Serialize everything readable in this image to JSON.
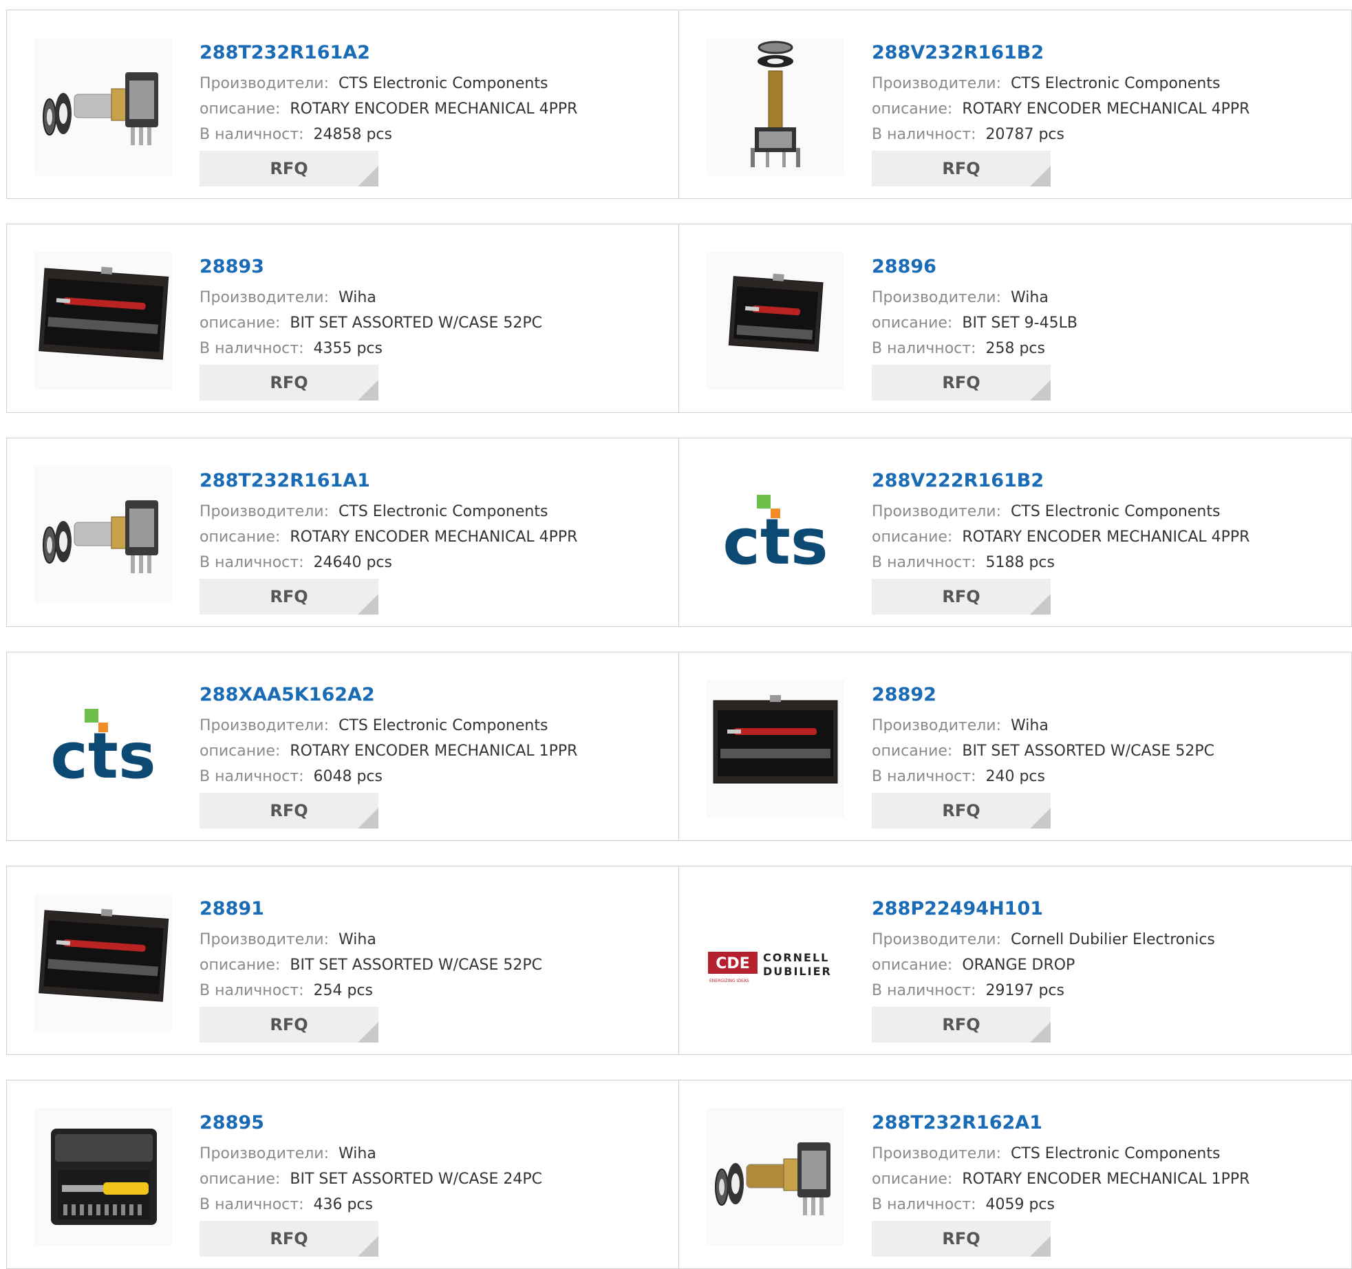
{
  "labels": {
    "manufacturer": "Производители:",
    "description": "описание:",
    "stock": "В наличност:",
    "rfq": "RFQ"
  },
  "products": [
    {
      "pn": "288T232R161A2",
      "mfr": "CTS Electronic Components",
      "desc": "ROTARY ENCODER MECHANICAL 4PPR",
      "stock": "24858 pcs",
      "image": "encoder-horizontal"
    },
    {
      "pn": "288V232R161B2",
      "mfr": "CTS Electronic Components",
      "desc": "ROTARY ENCODER MECHANICAL 4PPR",
      "stock": "20787 pcs",
      "image": "encoder-vertical"
    },
    {
      "pn": "28893",
      "mfr": "Wiha",
      "desc": "BIT SET ASSORTED W/CASE 52PC",
      "stock": "4355 pcs",
      "image": "bit-case"
    },
    {
      "pn": "28896",
      "mfr": "Wiha",
      "desc": "BIT SET 9-45LB",
      "stock": "258 pcs",
      "image": "bit-case-small"
    },
    {
      "pn": "288T232R161A1",
      "mfr": "CTS Electronic Components",
      "desc": "ROTARY ENCODER MECHANICAL 4PPR",
      "stock": "24640 pcs",
      "image": "encoder-horizontal"
    },
    {
      "pn": "288V222R161B2",
      "mfr": "CTS Electronic Components",
      "desc": "ROTARY ENCODER MECHANICAL 4PPR",
      "stock": "5188 pcs",
      "image": "cts-logo"
    },
    {
      "pn": "288XAA5K162A2",
      "mfr": "CTS Electronic Components",
      "desc": "ROTARY ENCODER MECHANICAL 1PPR",
      "stock": "6048 pcs",
      "image": "cts-logo"
    },
    {
      "pn": "28892",
      "mfr": "Wiha",
      "desc": "BIT SET ASSORTED W/CASE 52PC",
      "stock": "240 pcs",
      "image": "bit-case-open"
    },
    {
      "pn": "28891",
      "mfr": "Wiha",
      "desc": "BIT SET ASSORTED W/CASE 52PC",
      "stock": "254 pcs",
      "image": "bit-case"
    },
    {
      "pn": "288P22494H101",
      "mfr": "Cornell Dubilier Electronics",
      "desc": "ORANGE DROP",
      "stock": "29197 pcs",
      "image": "cde-logo"
    },
    {
      "pn": "28895",
      "mfr": "Wiha",
      "desc": "BIT SET ASSORTED W/CASE 24PC",
      "stock": "436 pcs",
      "image": "bit-case-24"
    },
    {
      "pn": "288T232R162A1",
      "mfr": "CTS Electronic Components",
      "desc": "ROTARY ENCODER MECHANICAL 1PPR",
      "stock": "4059 pcs",
      "image": "encoder-horizontal-2"
    }
  ],
  "logos": {
    "cts": "cts",
    "cde_mark": "CDE",
    "cde_line1": "CORNELL",
    "cde_line2": "DUBILIER",
    "cde_tag": "ENERGIZING IDEAS"
  },
  "colors": {
    "link": "#1a6bb5",
    "cts_blue": "#0d4a73",
    "cts_green": "#6cbf4a",
    "cts_orange": "#f28c28",
    "cde_red": "#b5202e"
  }
}
